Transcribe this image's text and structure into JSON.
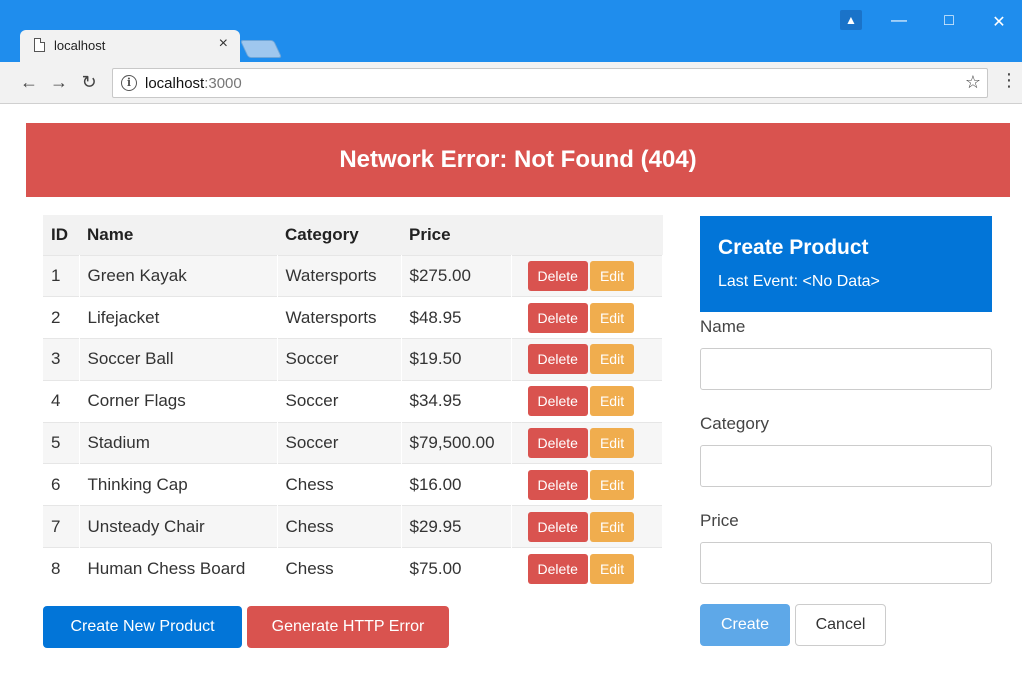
{
  "browser": {
    "tab_title": "localhost",
    "tab_close": "×",
    "url_host": "localhost",
    "url_port": ":3000",
    "colors": {
      "chrome": "#1f8ded"
    }
  },
  "alert": {
    "text": "Network Error: Not Found (404)",
    "color": "#d9534f"
  },
  "table": {
    "headers": [
      "ID",
      "Name",
      "Category",
      "Price",
      ""
    ],
    "rows": [
      {
        "id": "1",
        "name": "Green Kayak",
        "category": "Watersports",
        "price": "$275.00"
      },
      {
        "id": "2",
        "name": "Lifejacket",
        "category": "Watersports",
        "price": "$48.95"
      },
      {
        "id": "3",
        "name": "Soccer Ball",
        "category": "Soccer",
        "price": "$19.50"
      },
      {
        "id": "4",
        "name": "Corner Flags",
        "category": "Soccer",
        "price": "$34.95"
      },
      {
        "id": "5",
        "name": "Stadium",
        "category": "Soccer",
        "price": "$79,500.00"
      },
      {
        "id": "6",
        "name": "Thinking Cap",
        "category": "Chess",
        "price": "$16.00"
      },
      {
        "id": "7",
        "name": "Unsteady Chair",
        "category": "Chess",
        "price": "$29.95"
      },
      {
        "id": "8",
        "name": "Human Chess Board",
        "category": "Chess",
        "price": "$75.00"
      }
    ],
    "delete_label": "Delete",
    "edit_label": "Edit"
  },
  "buttons": {
    "create_new": "Create New Product",
    "generate_error": "Generate HTTP Error"
  },
  "form": {
    "title": "Create Product",
    "last_event": "Last Event: <No Data>",
    "name_label": "Name",
    "category_label": "Category",
    "price_label": "Price",
    "name_value": "",
    "category_value": "",
    "price_value": "",
    "create_label": "Create",
    "cancel_label": "Cancel"
  }
}
